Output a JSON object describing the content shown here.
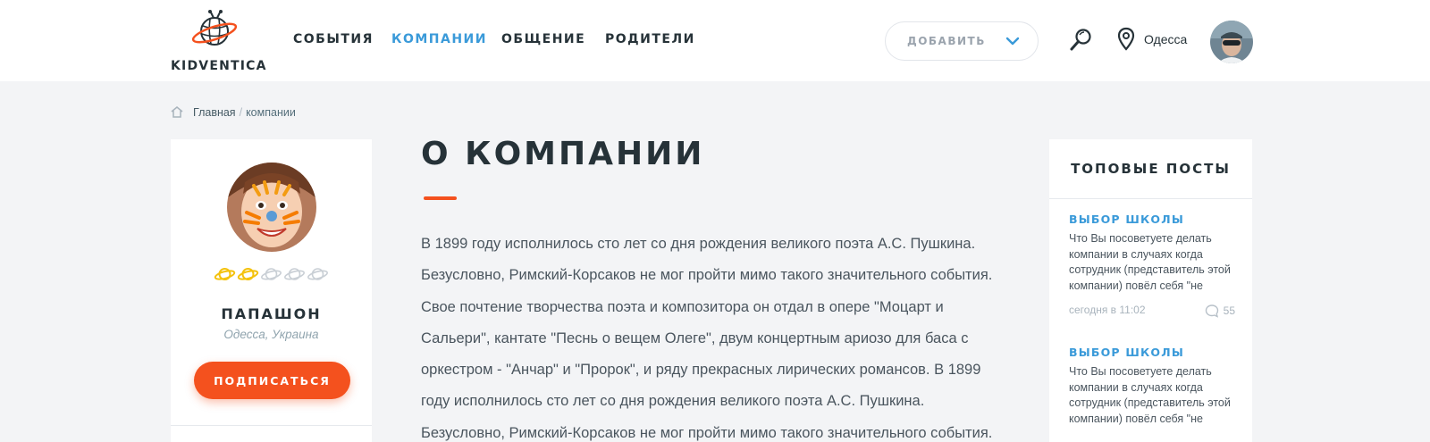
{
  "brand": {
    "name": "KIDVENTICA",
    "accent": "#f4511e",
    "link": "#3a9ad9"
  },
  "nav": [
    {
      "label": "СОБЫТИЯ",
      "active": false
    },
    {
      "label": "КОМПАНИИ",
      "active": true
    },
    {
      "label": "ОБЩЕНИЕ",
      "active": false
    },
    {
      "label": "РОДИТЕЛИ",
      "active": false
    }
  ],
  "header": {
    "add_label": "ДОБАВИТЬ",
    "city": "Одесса"
  },
  "breadcrumb": {
    "home": "Главная",
    "separator": "/",
    "current": "компании"
  },
  "profile": {
    "name": "ПАПАШОН",
    "location": "Одесса, Украина",
    "rating": 2,
    "rating_max": 5,
    "subscribe_label": "ПОДПИСАТЬСЯ"
  },
  "main": {
    "title": "О КОМПАНИИ",
    "text": "В 1899 году исполнилось сто лет со дня рождения великого поэта А.С. Пушкина. Безусловно, Римский-Корсаков не мог пройти мимо такого значительного события. Свое почтение творчества поэта и композитора он отдал в опере \"Моцарт и Сальери\", кантате \"Песнь о вещем Олеге\", двум концертным ариозо для баса с оркестром - \"Анчар\" и \"Пророк\", и ряду прекрасных лирических романсов. В 1899 году исполнилось сто лет со дня рождения великого поэта А.С. Пушкина. Безусловно, Римский-Корсаков не мог пройти мимо такого значительного события."
  },
  "top_posts": {
    "title": "ТОПОВЫЕ ПОСТЫ",
    "items": [
      {
        "category": "ВЫБОР ШКОЛЫ",
        "text": "Что Вы посоветуете делать компании в случаях когда сотрудник (представитель этой компании) повёл себя \"не",
        "time": "сегодня в 11:02",
        "comments": "55"
      },
      {
        "category": "ВЫБОР ШКОЛЫ",
        "text": "Что Вы посоветуете делать компании в случаях когда сотрудник (представитель этой компании) повёл себя \"не",
        "time": "",
        "comments": ""
      }
    ]
  },
  "icons": {
    "search": "search-icon",
    "location": "map-pin-icon",
    "home": "home-icon",
    "dropdown": "chevron-down-icon",
    "comment": "comment-icon",
    "rating": "planet-icon"
  }
}
